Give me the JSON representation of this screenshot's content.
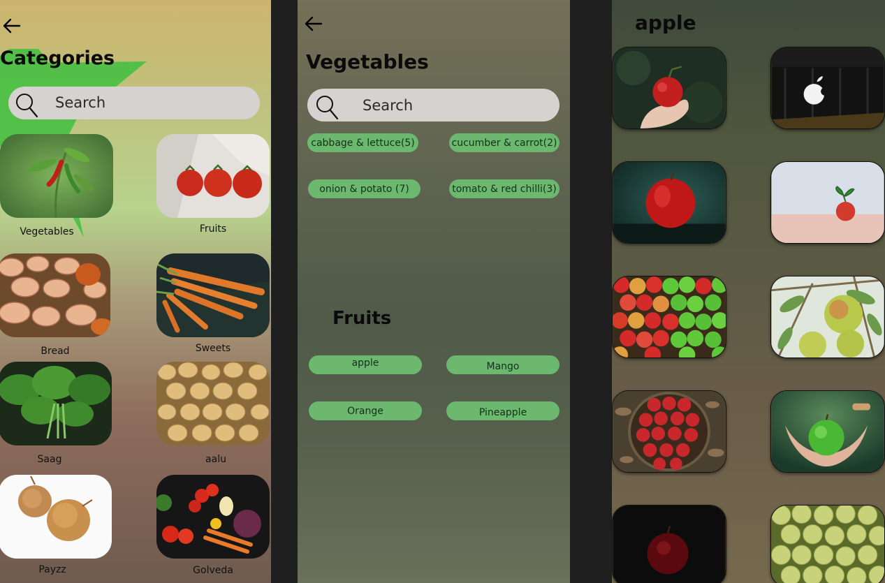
{
  "screen_categories": {
    "title": "Categories",
    "back_icon": "arrow-left-icon",
    "search": {
      "placeholder": "Search",
      "icon": "search-icon"
    },
    "items": [
      {
        "label": "Vegetables"
      },
      {
        "label": "Fruits"
      },
      {
        "label": "Bread"
      },
      {
        "label": "Sweets"
      },
      {
        "label": "Saag"
      },
      {
        "label": "aalu"
      },
      {
        "label": "Payzz"
      },
      {
        "label": "Golveda"
      }
    ]
  },
  "screen_vegetables": {
    "title": "Vegetables",
    "back_icon": "arrow-left-icon",
    "search": {
      "placeholder": "Search",
      "icon": "search-icon"
    },
    "vegetable_chips": [
      "cabbage & lettuce(5)",
      "cucumber & carrot(2)",
      "onion & potato (7)",
      "tomato & red chilli(3)"
    ],
    "fruits_heading": "Fruits",
    "fruit_chips": [
      "apple",
      "Mango",
      "Orange",
      "Pineapple"
    ]
  },
  "screen_apple": {
    "title": "apple",
    "photo_count_shown": 10
  },
  "colors": {
    "chip": "#6cb86f",
    "search_bg": "#d6d2cf",
    "star": "#3fbf3f",
    "divider": "#1f1f1f"
  }
}
